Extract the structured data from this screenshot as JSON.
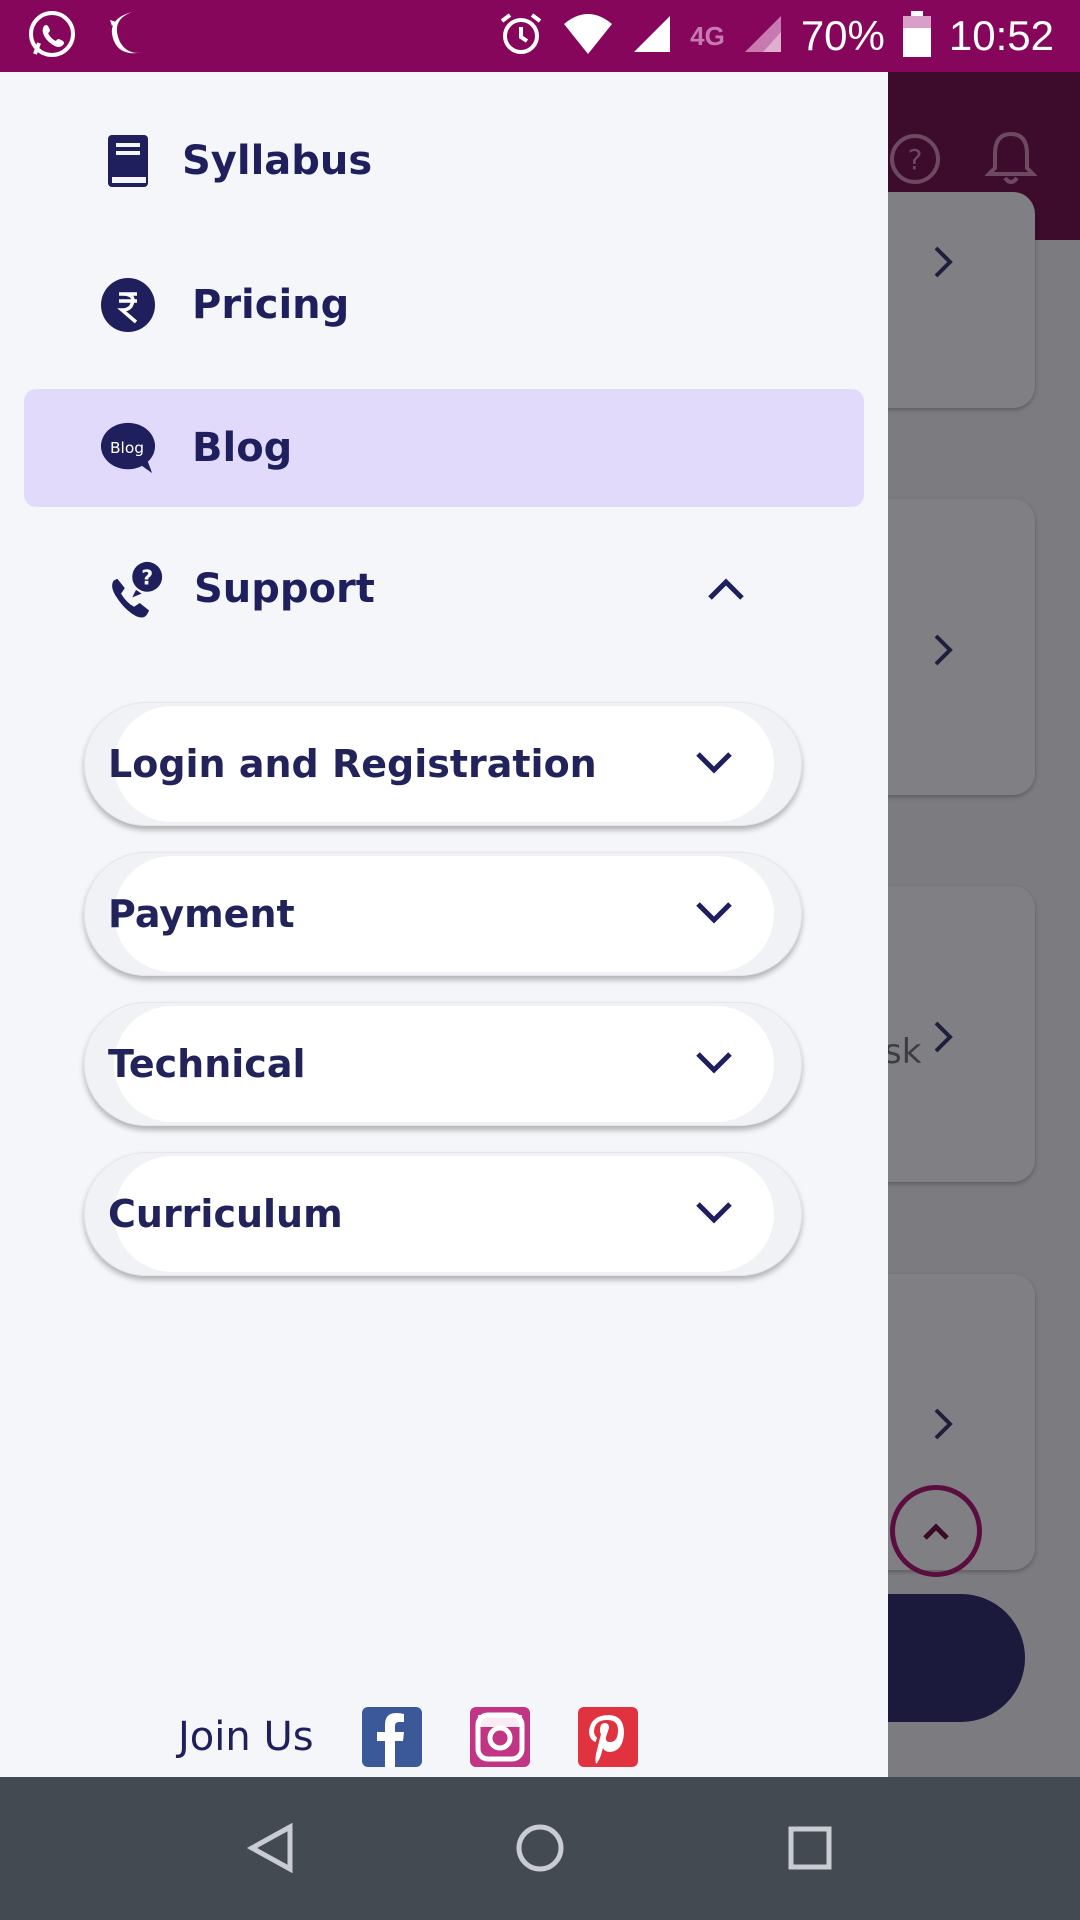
{
  "status_bar": {
    "network": "4G",
    "battery": "70%",
    "time": "10:52"
  },
  "drawer": {
    "menu": [
      {
        "label": "Syllabus",
        "icon": "book-icon"
      },
      {
        "label": "Pricing",
        "icon": "rupee-icon"
      },
      {
        "label": "Blog",
        "icon": "blog-bubble-icon",
        "icon_text": "Blog",
        "active": true
      },
      {
        "label": "Support",
        "icon": "support-phone-icon",
        "expanded": true
      }
    ],
    "support_topics": [
      {
        "label": "Login and Registration"
      },
      {
        "label": "Payment"
      },
      {
        "label": "Technical"
      },
      {
        "label": "Curriculum"
      }
    ],
    "join_us": {
      "label": "Join Us",
      "socials": [
        "facebook-icon",
        "instagram-icon",
        "pinterest-icon"
      ]
    }
  },
  "background": {
    "partial_text": "sk"
  },
  "colors": {
    "status_bar": "#86065c",
    "accent_text": "#1e1f5c",
    "active_item": "#e2dafa",
    "facebook": "#3b5998",
    "instagram": "#c13584",
    "pinterest": "#e0323f"
  }
}
